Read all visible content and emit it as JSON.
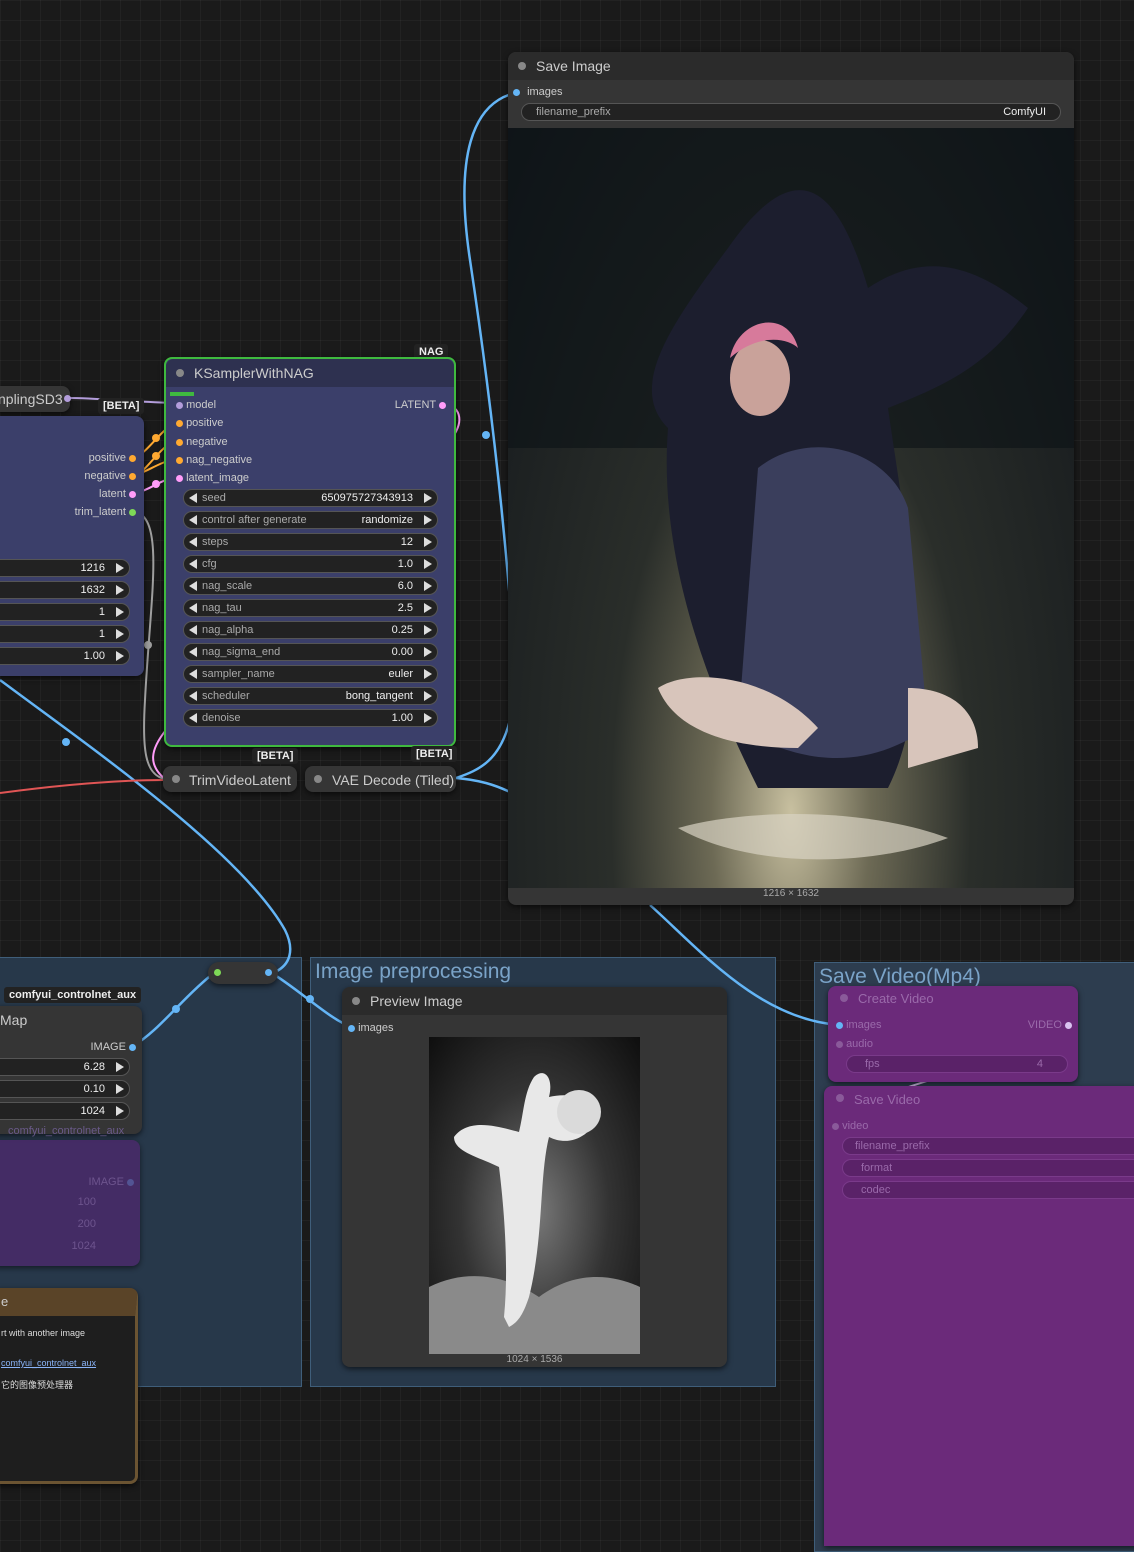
{
  "colors": {
    "model": "#b39ddb",
    "positive": "#ffa931",
    "latent": "#ff9cf9",
    "image": "#64b5f6",
    "video": "#8b5cf6",
    "int": "#7ed957",
    "group_blue": "#3f5e7a",
    "group_purple": "#6b2a7a",
    "group_brown": "#7a5a30",
    "selected": "#3fb93f"
  },
  "save_image": {
    "title": "Save Image",
    "input": "images",
    "widget_label": "filename_prefix",
    "widget_value": "ComfyUI",
    "caption": "1216 × 1632",
    "icon": "generated-photo"
  },
  "sampling": {
    "title": "nplingSD3",
    "badge": "[BETA]"
  },
  "latent_node": {
    "outputs": [
      "positive",
      "negative",
      "latent",
      "trim_latent"
    ],
    "values": [
      "1216",
      "1632",
      "1",
      "1",
      "1.00"
    ]
  },
  "ksampler": {
    "title": "KSamplerWithNAG",
    "badge": "NAG",
    "output": "LATENT",
    "inputs": [
      "model",
      "positive",
      "negative",
      "nag_negative",
      "latent_image"
    ],
    "widgets": [
      {
        "label": "seed",
        "value": "650975727343913"
      },
      {
        "label": "control after generate",
        "value": "randomize"
      },
      {
        "label": "steps",
        "value": "12"
      },
      {
        "label": "cfg",
        "value": "1.0"
      },
      {
        "label": "nag_scale",
        "value": "6.0"
      },
      {
        "label": "nag_tau",
        "value": "2.5"
      },
      {
        "label": "nag_alpha",
        "value": "0.25"
      },
      {
        "label": "nag_sigma_end",
        "value": "0.00"
      },
      {
        "label": "sampler_name",
        "value": "euler"
      },
      {
        "label": "scheduler",
        "value": "bong_tangent"
      },
      {
        "label": "denoise",
        "value": "1.00"
      }
    ]
  },
  "trim": {
    "title": "TrimVideoLatent",
    "badge": "[BETA]"
  },
  "vae": {
    "title": "VAE Decode (Tiled)",
    "badge": "[BETA]"
  },
  "group_preprocess": {
    "title": "Image preprocessing"
  },
  "preview": {
    "title": "Preview Image",
    "input": "images",
    "caption": "1024 × 1536",
    "icon": "depth-map"
  },
  "controlnet": {
    "badge": "comfyui_controlnet_aux",
    "title": "Map",
    "output": "IMAGE",
    "values": [
      "6.28",
      "0.10",
      "1024"
    ]
  },
  "controlnet2": {
    "badge": "comfyui_controlnet_aux",
    "output": "IMAGE",
    "values": [
      "100",
      "200",
      "1024"
    ]
  },
  "note": {
    "title": "e",
    "lines": [
      "rt with another image",
      "comfyui_controlnet_aux",
      "它的图像预处理器"
    ]
  },
  "group_video": {
    "title": "Save Video(Mp4)"
  },
  "create_video": {
    "title": "Create Video",
    "inputs": [
      "images",
      "audio"
    ],
    "output": "VIDEO",
    "widget_label": "fps",
    "widget_value": "4"
  },
  "save_video": {
    "title": "Save Video",
    "input": "video",
    "widgets": [
      "filename_prefix",
      "format",
      "codec"
    ]
  }
}
